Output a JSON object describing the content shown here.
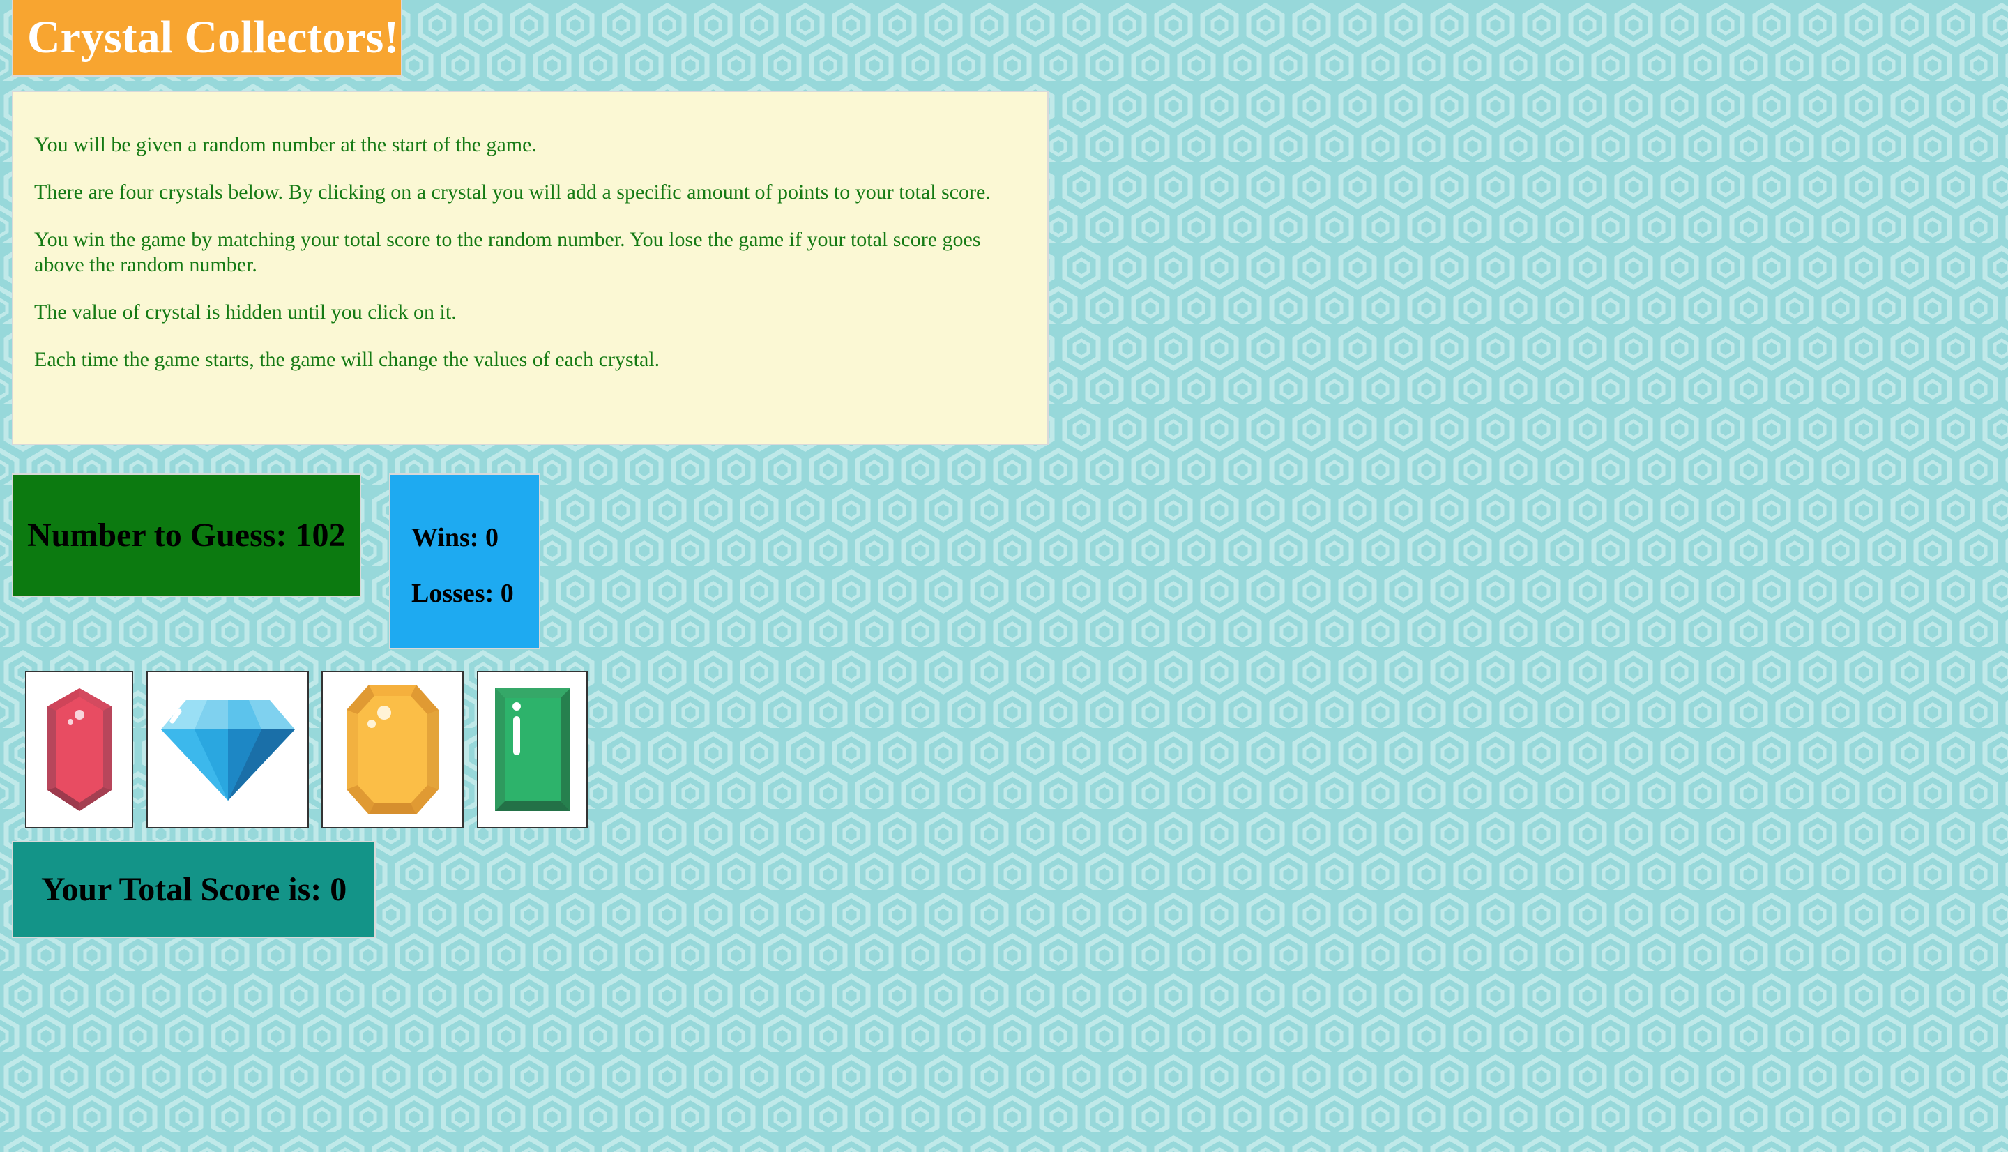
{
  "title": "Crystal Collectors!",
  "instructions": [
    "You will be given a random number at the start of the game.",
    "There are four crystals below. By clicking on a crystal you will add a specific amount of points to your total score.",
    "You win the game by matching your total score to the random number. You lose the game if your total score goes above the random number.",
    "The value of crystal is hidden until you click on it.",
    "Each time the game starts, the game will change the values of each crystal."
  ],
  "target": {
    "label": "Number to Guess:",
    "value": "102",
    "text": "Number to Guess: 102"
  },
  "record": {
    "wins_text": "Wins: 0",
    "losses_text": "Losses: 0",
    "wins": 0,
    "losses": 0
  },
  "crystals": [
    {
      "name": "red-crystal",
      "icon": "red-gem-icon",
      "color": "#e84c62"
    },
    {
      "name": "blue-diamond",
      "icon": "blue-diamond-icon",
      "color": "#2aa7e0"
    },
    {
      "name": "yellow-crystal",
      "icon": "yellow-gem-icon",
      "color": "#fbbe47"
    },
    {
      "name": "green-crystal",
      "icon": "green-gem-icon",
      "color": "#2db36b"
    }
  ],
  "score": {
    "text": "Your Total Score is: 0",
    "value": 0
  },
  "colors": {
    "title_bg": "#f8a530",
    "instructions_bg": "#fbf8d4",
    "instructions_text": "#157a14",
    "target_bg": "#0c7a10",
    "record_bg": "#1eaaf1",
    "score_bg": "#139488",
    "page_bg": "#97d8da"
  }
}
